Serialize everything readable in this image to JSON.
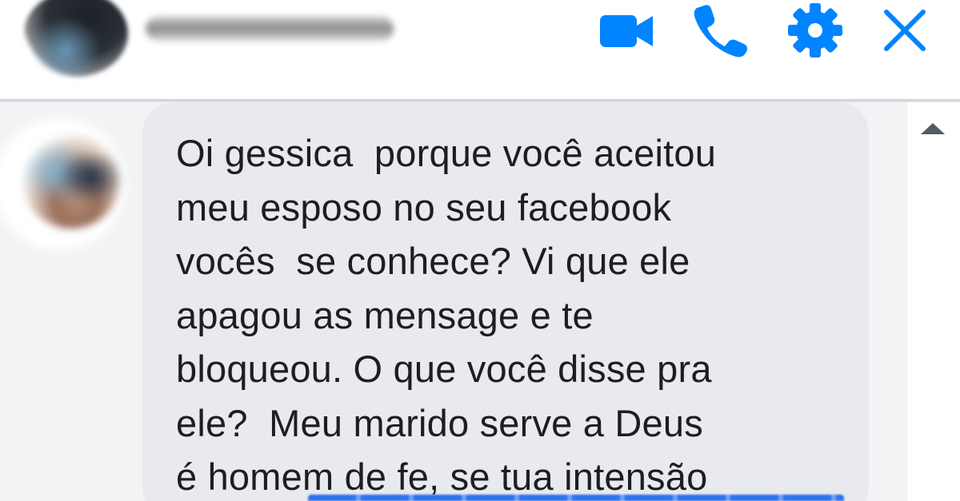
{
  "header": {
    "contact_name": "",
    "actions": [
      {
        "name": "video-call",
        "icon": "video-camera-icon"
      },
      {
        "name": "voice-call",
        "icon": "phone-icon"
      },
      {
        "name": "settings",
        "icon": "gear-icon"
      },
      {
        "name": "close",
        "icon": "close-icon"
      }
    ]
  },
  "message": {
    "sender": "incoming",
    "text": "Oi gessica  porque você aceitou\nmeu esposo no seu facebook\nvocês  se conhece? Vi que ele\napagou as mensage e te\nbloqueou. O que você disse pra\nele?  Meu marido serve a Deus\né homem de fe, se tua intensão"
  },
  "colors": {
    "accent": "#0084ff",
    "bubble_incoming": "#e9eaed",
    "text": "#1c1e21",
    "background": "#f2f3f5"
  }
}
